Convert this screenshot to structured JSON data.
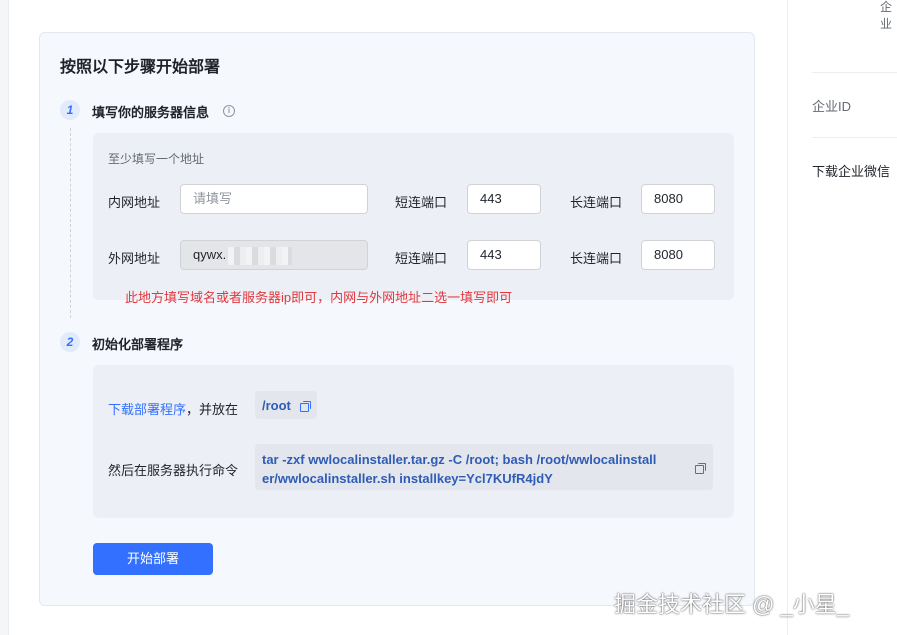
{
  "right_panel": {
    "top_text": "企业",
    "enterprise_id_label": "企业ID",
    "download_label": "下载企业微信"
  },
  "card": {
    "title": "按照以下步骤开始部署",
    "step1": {
      "number": "1",
      "title": "填写你的服务器信息",
      "info_icon": "info-circle-icon",
      "hint": "至少填写一个地址",
      "intranet": {
        "label": "内网地址",
        "placeholder": "请填写",
        "short_port_label": "短连端口",
        "short_port_value": "443",
        "long_port_label": "长连端口",
        "long_port_value": "8080"
      },
      "extranet": {
        "label": "外网地址",
        "value": "qywx.",
        "short_port_label": "短连端口",
        "short_port_value": "443",
        "long_port_label": "长连端口",
        "long_port_value": "8080"
      },
      "annotation": "此地方填写域名或者服务器ip即可，内网与外网地址二选一填写即可"
    },
    "step2": {
      "number": "2",
      "title": "初始化部署程序",
      "download_link": "下载部署程序",
      "place_in_text": "，并放在",
      "path": "/root",
      "exec_label": "然后在服务器执行命令",
      "command_line1": "tar -zxf wwlocalinstaller.tar.gz -C /root; bash /root/wwlocalinstall",
      "command_line2": "er/wwlocalinstaller.sh installkey=Ycl7KUfR4jdY",
      "copy_icon": "copy-icon"
    },
    "start_button": "开始部署"
  },
  "watermark": "掘金技术社区 @ _小星_",
  "colors": {
    "accent": "#3370ff",
    "annotation_red": "#e0393e",
    "card_bg": "#f5f8fd",
    "box_bg": "#eceff5"
  }
}
